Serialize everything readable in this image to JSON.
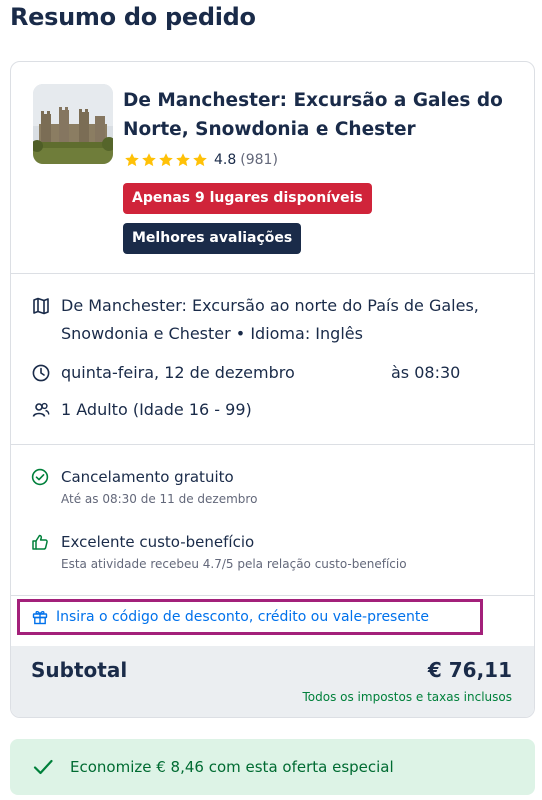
{
  "page": {
    "title": "Resumo do pedido"
  },
  "activity": {
    "title": "De Manchester: Excursão a Gales do Norte, Snowdonia e Chester",
    "rating": "4.8",
    "reviews": "(981)",
    "stars": 5,
    "badges": {
      "availability": "Apenas 9 lugares disponíveis",
      "top_rated": "Melhores avaliações"
    }
  },
  "details": {
    "option": "De Manchester: Excursão ao norte do País de Gales, Snowdonia e Chester • Idioma: Inglês",
    "date": "quinta-feira, 12 de dezembro",
    "time": "às 08:30",
    "participants": "1 Adulto (Idade 16 - 99)"
  },
  "benefits": {
    "cancellation": {
      "title": "Cancelamento gratuito",
      "subtitle": "Até as 08:30 de 11 de dezembro"
    },
    "value": {
      "title": "Excelente custo-benefício",
      "subtitle": "Esta atividade recebeu 4.7/5 pela relação custo-benefício"
    }
  },
  "promo": {
    "link_label": "Insira o código de desconto, crédito ou vale-presente"
  },
  "subtotal": {
    "label": "Subtotal",
    "amount": "€ 76,11",
    "taxes_note": "Todos os impostos e taxas inclusos"
  },
  "savings": {
    "text": "Economize € 8,46 com esta oferta especial"
  },
  "colors": {
    "primary_text": "#1a2b49",
    "badge_red": "#d0243a",
    "badge_dark": "#1a2b49",
    "link_blue": "#0071eb",
    "success_green": "#00803b",
    "highlight_border": "#a3207a",
    "star_yellow": "#ffc107"
  }
}
